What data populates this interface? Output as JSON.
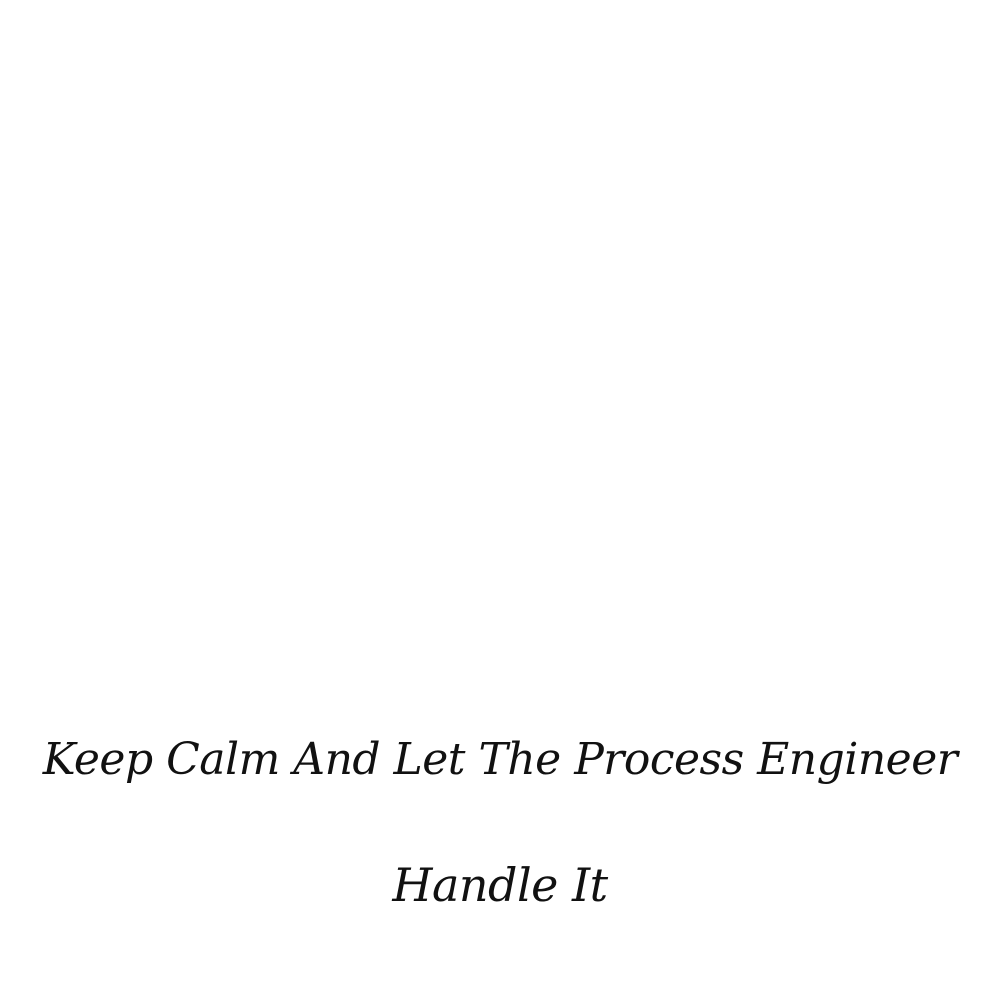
{
  "quote": {
    "line1": "Keep Calm And Let The Process Engineer",
    "line2": "Handle It"
  },
  "colors": {
    "background": "#ffffff",
    "text": "#111111"
  }
}
